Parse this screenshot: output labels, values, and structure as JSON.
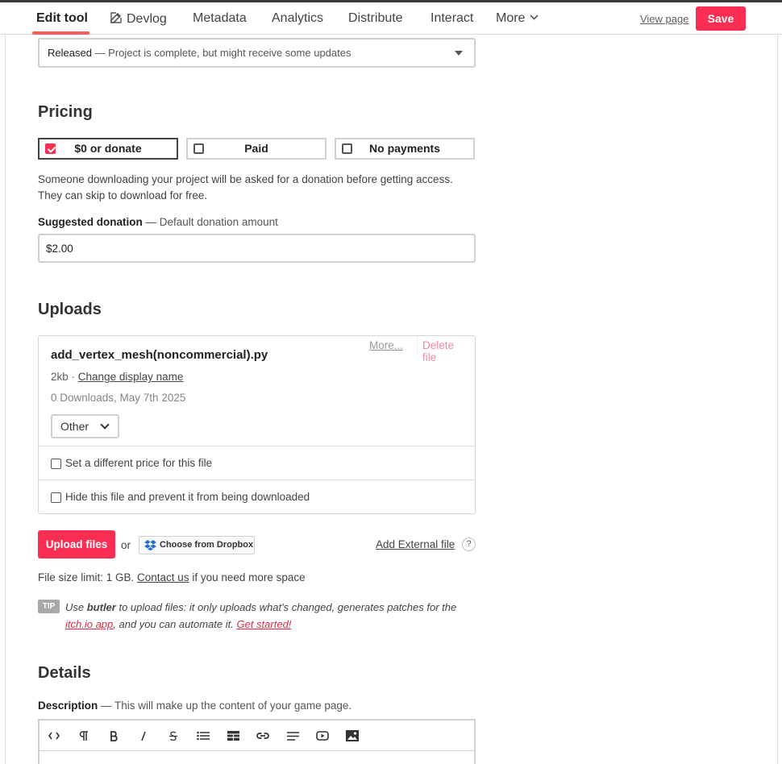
{
  "header": {
    "tabs": [
      "Edit tool",
      "Devlog",
      "Metadata",
      "Analytics",
      "Distribute",
      "Interact",
      "More"
    ],
    "view_page": "View page",
    "save": "Save"
  },
  "release": {
    "status": "Released",
    "description": " — Project is complete, but might receive some updates"
  },
  "pricing": {
    "heading": "Pricing",
    "options": [
      "$0 or donate",
      "Paid",
      "No payments"
    ],
    "selected": "$0 or donate",
    "help_line1": "Someone downloading your project will be asked for a donation before getting access.",
    "help_line2": "They can skip to download for free.",
    "donation_label": "Suggested donation",
    "donation_hint": " — Default donation amount",
    "donation_value": "$2.00"
  },
  "uploads": {
    "heading": "Uploads",
    "file": {
      "name": "add_vertex_mesh(noncommercial).py",
      "size": "2kb",
      "size_sep": " · ",
      "change_name": "Change display name",
      "downloads": "0 Downloads, May 7th 2025",
      "type": "Other",
      "more": "More...",
      "delete": "Delete file",
      "option_price": "Set a different price for this file",
      "option_hide": "Hide this file and prevent it from being downloaded"
    },
    "upload_button": "Upload files",
    "or": "or",
    "dropbox": "Choose from Dropbox",
    "external": "Add External file",
    "help": "?",
    "limit_prefix": "File size limit: 1 GB. ",
    "contact": "Contact us",
    "limit_suffix": " if you need more space",
    "tip_badge": "TIP",
    "tip_1": "Use ",
    "tip_butler": "butler",
    "tip_2": " to upload files: it only uploads what's changed, generates patches for the ",
    "tip_app": "itch.io app",
    "tip_3": ", and you can automate it. ",
    "tip_start": "Get started!"
  },
  "details": {
    "heading": "Details",
    "desc_label": "Description",
    "desc_hint": " — This will make up the content of your game page."
  },
  "toolbar_icons": [
    "code-icon",
    "paragraph-icon",
    "bold-icon",
    "italic-icon",
    "strikethrough-icon",
    "bullet-list-icon",
    "table-icon",
    "link-icon",
    "align-icon",
    "video-icon",
    "image-icon"
  ],
  "colors": {
    "accent": "#fa2d52",
    "text": "#434343"
  }
}
